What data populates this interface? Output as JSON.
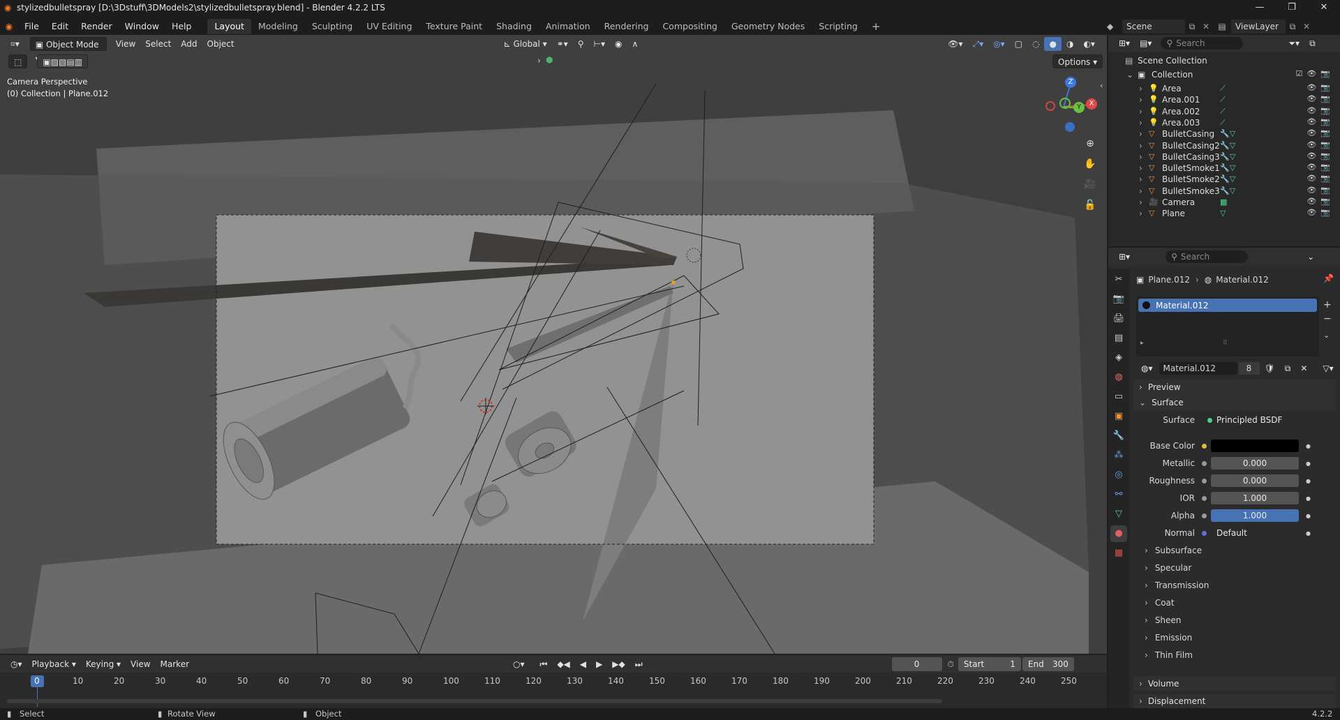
{
  "titlebar": {
    "title": "stylizedbulletspray [D:\\3Dstuff\\3DModels2\\stylizedbulletspray.blend] - Blender 4.2.2 LTS"
  },
  "menubar": {
    "items": [
      "File",
      "Edit",
      "Render",
      "Window",
      "Help"
    ],
    "workspaces": [
      "Layout",
      "Modeling",
      "Sculpting",
      "UV Editing",
      "Texture Paint",
      "Shading",
      "Animation",
      "Rendering",
      "Compositing",
      "Geometry Nodes",
      "Scripting"
    ],
    "active_workspace": "Layout",
    "scene": "Scene",
    "view_layer": "ViewLayer"
  },
  "viewport": {
    "mode": "Object Mode",
    "menus": [
      "View",
      "Select",
      "Add",
      "Object"
    ],
    "transform_orientation": "Global",
    "options_label": "Options",
    "camera_label": "Camera Perspective",
    "collection_label": "(0) Collection | Plane.012",
    "axes": [
      "Z",
      "Y",
      "X"
    ]
  },
  "timeline": {
    "menus": [
      "Playback",
      "Keying",
      "View",
      "Marker"
    ],
    "current_frame": "0",
    "start_label": "Start",
    "start": "1",
    "end_label": "End",
    "end": "300",
    "ticks": [
      "0",
      "10",
      "20",
      "30",
      "40",
      "50",
      "60",
      "70",
      "80",
      "90",
      "100",
      "110",
      "120",
      "130",
      "140",
      "150",
      "160",
      "170",
      "180",
      "190",
      "200",
      "210",
      "220",
      "230",
      "240",
      "250"
    ]
  },
  "statusbar": {
    "select": "Select",
    "rotate": "Rotate View",
    "object": "Object",
    "version": "4.2.2"
  },
  "outliner": {
    "search_placeholder": "Search",
    "scene_collection": "Scene Collection",
    "collection": "Collection",
    "items": [
      {
        "name": "Area",
        "type": "light"
      },
      {
        "name": "Area.001",
        "type": "light"
      },
      {
        "name": "Area.002",
        "type": "light"
      },
      {
        "name": "Area.003",
        "type": "light"
      },
      {
        "name": "BulletCasing",
        "type": "mesh"
      },
      {
        "name": "BulletCasing2",
        "type": "mesh"
      },
      {
        "name": "BulletCasing3",
        "type": "mesh"
      },
      {
        "name": "BulletSmoke1",
        "type": "mesh"
      },
      {
        "name": "BulletSmoke2",
        "type": "mesh"
      },
      {
        "name": "BulletSmoke3",
        "type": "mesh"
      },
      {
        "name": "Camera",
        "type": "camera"
      },
      {
        "name": "Plane",
        "type": "mesh"
      }
    ]
  },
  "properties": {
    "search_placeholder": "Search",
    "breadcrumb_object": "Plane.012",
    "breadcrumb_material": "Material.012",
    "slot_name": "Material.012",
    "material_name": "Material.012",
    "users": "8",
    "preview_label": "Preview",
    "surface_section": "Surface",
    "surface_label": "Surface",
    "surface_value": "Principled BSDF",
    "fields": [
      {
        "label": "Base Color",
        "value": ""
      },
      {
        "label": "Metallic",
        "value": "0.000"
      },
      {
        "label": "Roughness",
        "value": "0.000"
      },
      {
        "label": "IOR",
        "value": "1.000"
      },
      {
        "label": "Alpha",
        "value": "1.000"
      },
      {
        "label": "Normal",
        "value": "Default"
      }
    ],
    "subsections": [
      "Subsurface",
      "Specular",
      "Transmission",
      "Coat",
      "Sheen",
      "Emission",
      "Thin Film"
    ],
    "volume_label": "Volume",
    "displacement_label": "Displacement"
  },
  "colors": {
    "accent": "#4772b3",
    "bg": "#1d1d1d",
    "panel": "#2b2b2b",
    "viewport": "#3d3d3d",
    "frame": "#4a7ad1"
  }
}
